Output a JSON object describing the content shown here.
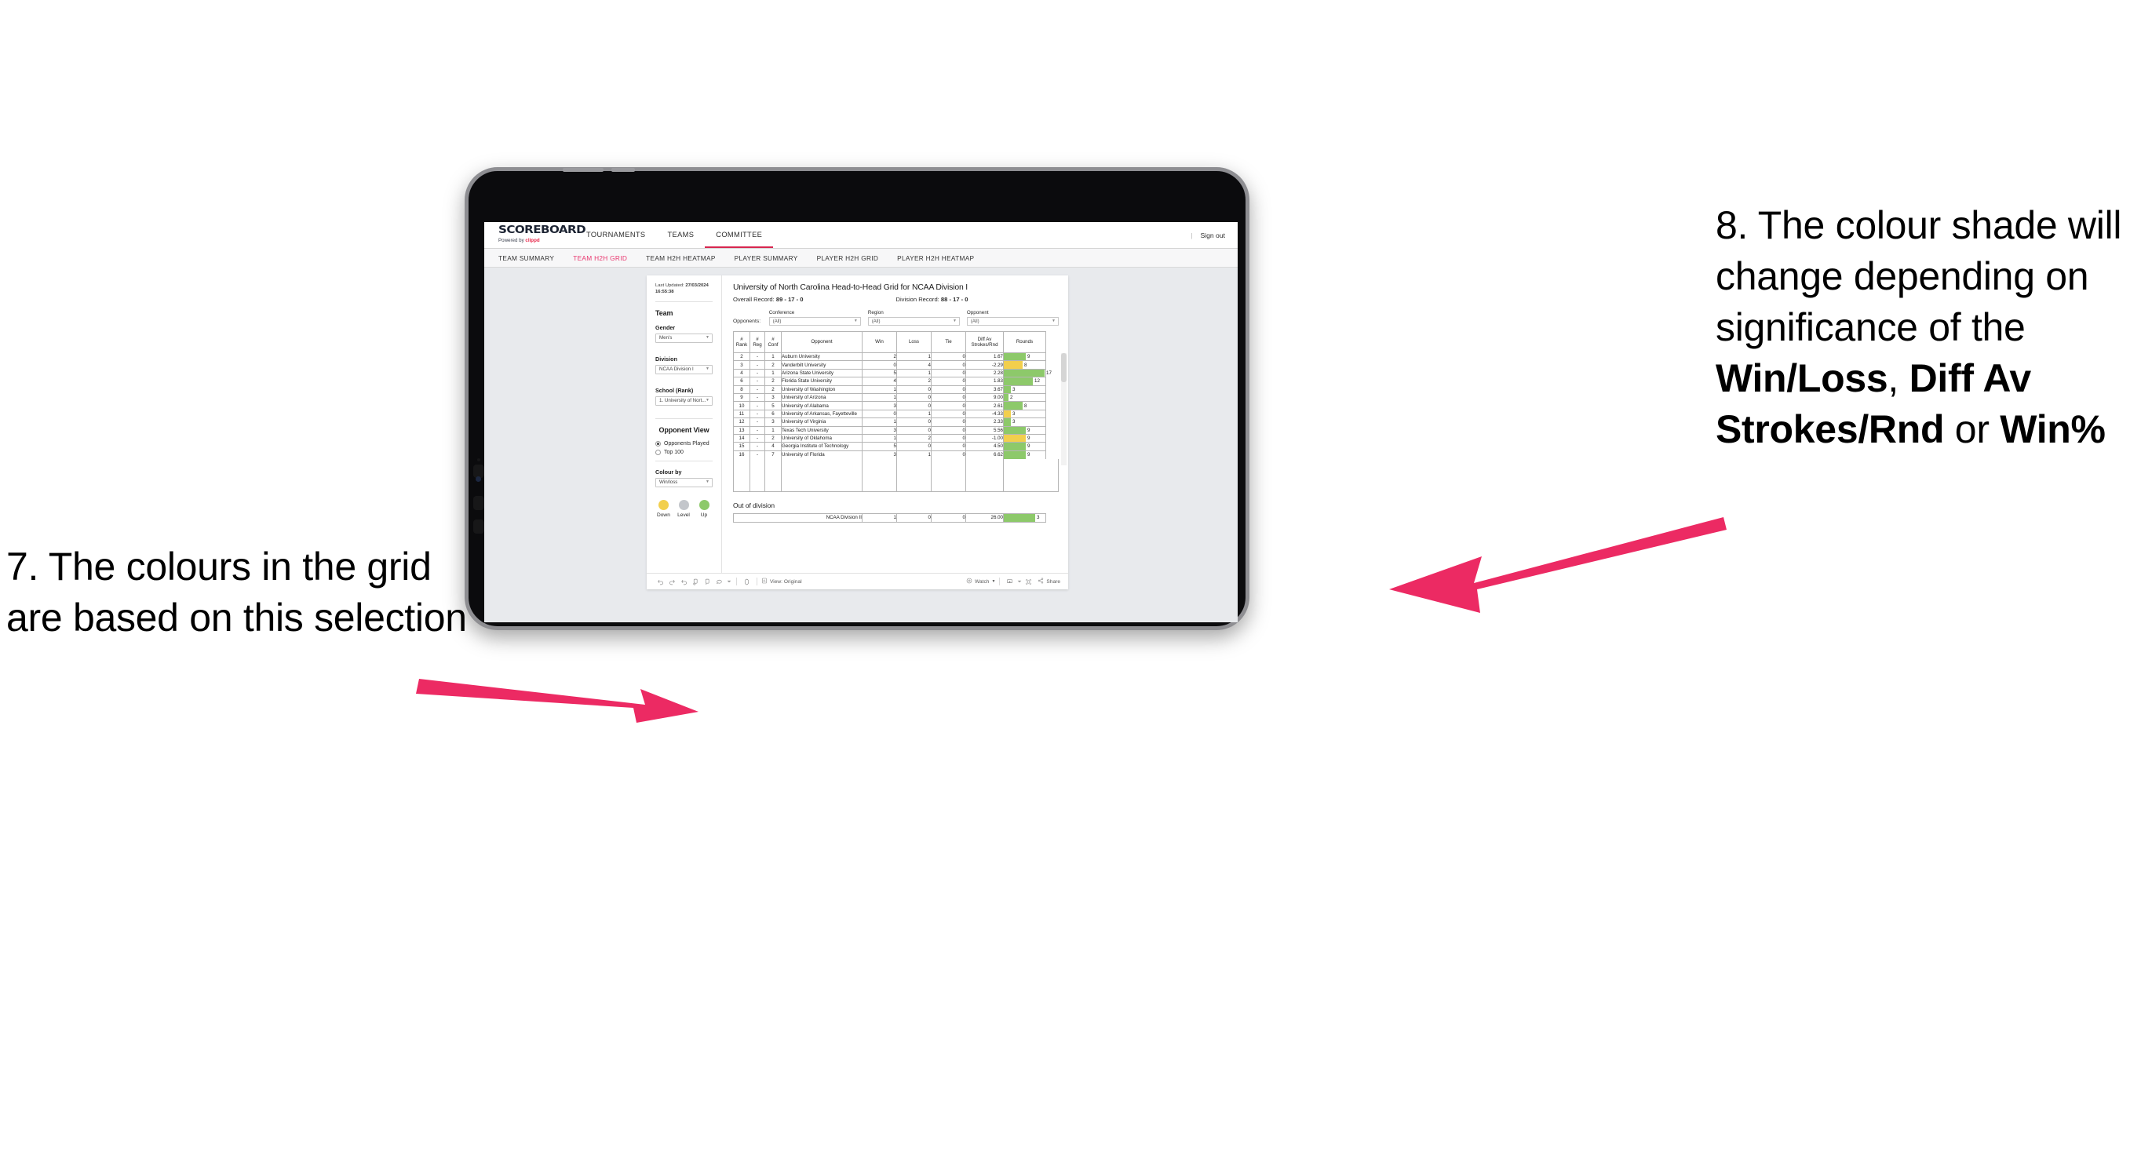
{
  "annotations": {
    "left": "7. The colours in the grid are based on this selection",
    "right_parts": [
      {
        "t": "8. The colour shade will change depending on significance of the ",
        "b": false
      },
      {
        "t": "Win/Loss",
        "b": true
      },
      {
        "t": ", ",
        "b": false
      },
      {
        "t": "Diff Av Strokes/Rnd",
        "b": true
      },
      {
        "t": " or ",
        "b": false
      },
      {
        "t": "Win%",
        "b": true
      }
    ],
    "arrow_color": "#ec2a63"
  },
  "app": {
    "logo": {
      "word": "SCOREBOARD",
      "powered_prefix": "Powered by ",
      "brand": "clippd"
    },
    "topnav": [
      {
        "label": "TOURNAMENTS",
        "active": false
      },
      {
        "label": "TEAMS",
        "active": false
      },
      {
        "label": "COMMITTEE",
        "active": true
      }
    ],
    "signout": {
      "divider": "|",
      "label": "Sign out"
    },
    "subnav": [
      {
        "label": "TEAM SUMMARY",
        "active": false
      },
      {
        "label": "TEAM H2H GRID",
        "active": true
      },
      {
        "label": "TEAM H2H HEATMAP",
        "active": false
      },
      {
        "label": "PLAYER SUMMARY",
        "active": false
      },
      {
        "label": "PLAYER H2H GRID",
        "active": false
      },
      {
        "label": "PLAYER H2H HEATMAP",
        "active": false
      }
    ],
    "accent": "#e8356d"
  },
  "sidebar": {
    "last_updated_label": "Last Updated: ",
    "last_updated_value": "27/03/2024 16:55:38",
    "team_heading": "Team",
    "gender_label": "Gender",
    "gender_value": "Men's",
    "division_label": "Division",
    "division_value": "NCAA Division I",
    "school_label": "School (Rank)",
    "school_value": "1. University of Nort...",
    "opponent_view_heading": "Opponent View",
    "opponent_view_options": [
      {
        "label": "Opponents Played",
        "selected": true
      },
      {
        "label": "Top 100",
        "selected": false
      }
    ],
    "colour_by_label": "Colour by",
    "colour_by_value": "Win/loss",
    "legend": [
      {
        "label": "Down",
        "color": "#f2cf4d"
      },
      {
        "label": "Level",
        "color": "#c3c6cb"
      },
      {
        "label": "Up",
        "color": "#8dc96a"
      }
    ]
  },
  "viz": {
    "title": "University of North Carolina Head-to-Head Grid for NCAA Division I",
    "overall_record_label": "Overall Record: ",
    "overall_record_value": "89 - 17 - 0",
    "division_record_label": "Division Record: ",
    "division_record_value": "88 - 17 - 0",
    "opponents_label": "Opponents:",
    "filters": [
      {
        "label": "Conference",
        "value": "(All)"
      },
      {
        "label": "Region",
        "value": "(All)"
      },
      {
        "label": "Opponent",
        "value": "(All)"
      }
    ],
    "columns": [
      "# Rank",
      "# Reg",
      "# Conf",
      "Opponent",
      "Win",
      "Loss",
      "Tie",
      "Diff Av Strokes/Rnd",
      "Rounds"
    ],
    "out_of_division_title": "Out of division"
  },
  "chart_data": {
    "type": "table",
    "title": "University of North Carolina Head-to-Head Grid for NCAA Division I",
    "columns": [
      "# Rank",
      "# Reg",
      "# Conf",
      "Opponent",
      "Win",
      "Loss",
      "Tie",
      "Diff Av Strokes/Rnd",
      "Rounds"
    ],
    "colour_by": "Win/loss",
    "colour_scale": {
      "down": "#f2cf4d",
      "level": "#c3c6cb",
      "up": "#8dc96a"
    },
    "rounds_max": 17,
    "rows": [
      {
        "rank": "2",
        "reg": "-",
        "conf": "1",
        "opponent": "Auburn University",
        "win": "2",
        "loss": "1",
        "tie": "0",
        "diff": "1.67",
        "rounds": 9,
        "state": "up"
      },
      {
        "rank": "3",
        "reg": "-",
        "conf": "2",
        "opponent": "Vanderbilt University",
        "win": "0",
        "loss": "4",
        "tie": "0",
        "diff": "-2.29",
        "rounds": 8,
        "state": "down"
      },
      {
        "rank": "4",
        "reg": "-",
        "conf": "1",
        "opponent": "Arizona State University",
        "win": "5",
        "loss": "1",
        "tie": "0",
        "diff": "2.28",
        "rounds": 17,
        "state": "up"
      },
      {
        "rank": "6",
        "reg": "-",
        "conf": "2",
        "opponent": "Florida State University",
        "win": "4",
        "loss": "2",
        "tie": "0",
        "diff": "1.83",
        "rounds": 12,
        "state": "up"
      },
      {
        "rank": "8",
        "reg": "-",
        "conf": "2",
        "opponent": "University of Washington",
        "win": "1",
        "loss": "0",
        "tie": "0",
        "diff": "3.67",
        "rounds": 3,
        "state": "up"
      },
      {
        "rank": "9",
        "reg": "-",
        "conf": "3",
        "opponent": "University of Arizona",
        "win": "1",
        "loss": "0",
        "tie": "0",
        "diff": "9.00",
        "rounds": 2,
        "state": "up"
      },
      {
        "rank": "10",
        "reg": "-",
        "conf": "5",
        "opponent": "University of Alabama",
        "win": "3",
        "loss": "0",
        "tie": "0",
        "diff": "2.61",
        "rounds": 8,
        "state": "up"
      },
      {
        "rank": "11",
        "reg": "-",
        "conf": "6",
        "opponent": "University of Arkansas, Fayetteville",
        "win": "0",
        "loss": "1",
        "tie": "0",
        "diff": "-4.33",
        "rounds": 3,
        "state": "down"
      },
      {
        "rank": "12",
        "reg": "-",
        "conf": "3",
        "opponent": "University of Virginia",
        "win": "1",
        "loss": "0",
        "tie": "0",
        "diff": "2.33",
        "rounds": 3,
        "state": "up"
      },
      {
        "rank": "13",
        "reg": "-",
        "conf": "1",
        "opponent": "Texas Tech University",
        "win": "3",
        "loss": "0",
        "tie": "0",
        "diff": "5.56",
        "rounds": 9,
        "state": "up"
      },
      {
        "rank": "14",
        "reg": "-",
        "conf": "2",
        "opponent": "University of Oklahoma",
        "win": "1",
        "loss": "2",
        "tie": "0",
        "diff": "-1.00",
        "rounds": 9,
        "state": "down"
      },
      {
        "rank": "15",
        "reg": "-",
        "conf": "4",
        "opponent": "Georgia Institute of Technology",
        "win": "5",
        "loss": "0",
        "tie": "0",
        "diff": "4.50",
        "rounds": 9,
        "state": "up"
      },
      {
        "rank": "16",
        "reg": "-",
        "conf": "7",
        "opponent": "University of Florida",
        "win": "3",
        "loss": "1",
        "tie": "0",
        "diff": "6.62",
        "rounds": 9,
        "state": "up"
      }
    ],
    "out_of_division": [
      {
        "opponent": "NCAA Division II",
        "win": "1",
        "loss": "0",
        "tie": "0",
        "diff": "26.00",
        "rounds": 3,
        "state": "up"
      }
    ]
  },
  "toolbar": {
    "view_label": "View: Original",
    "watch_label": "Watch",
    "share_label": "Share"
  }
}
